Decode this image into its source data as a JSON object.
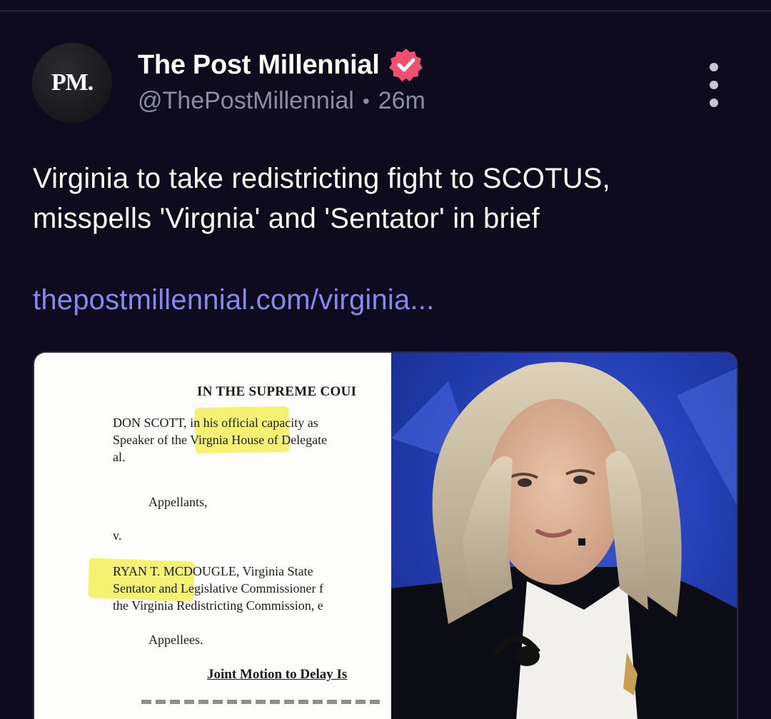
{
  "post": {
    "author": {
      "avatar_text": "PM.",
      "display_name": "The Post Millennial",
      "handle": "@ThePostMillennial",
      "separator": "•",
      "time_ago": "26m"
    },
    "text_line1": "Virginia to take redistricting fight to SCOTUS,",
    "text_line2": "misspells 'Virgnia' and 'Sentator' in brief",
    "link": "thepostmillennial.com/virginia...",
    "colors": {
      "background": "#0d0b1d",
      "link": "#8a88f0",
      "verified_badge": "#f0506e",
      "highlight": "#f3f05a"
    },
    "media": {
      "document": {
        "heading": "IN THE SUPREME COUI",
        "line1": "DON SCOTT, in his official capacity as",
        "line2": "Speaker of the Virgnia House of Delegate",
        "line3": "al.",
        "appellants": "Appellants,",
        "versus": "v.",
        "line4": "RYAN T. MCDOUGLE, Virginia State",
        "line5": "Sentator and Legislative Commissioner f",
        "line6": "the Virginia Redistricting Commission, e",
        "appellees": "Appellees.",
        "motion": "Joint Motion to Delay Is"
      }
    }
  }
}
